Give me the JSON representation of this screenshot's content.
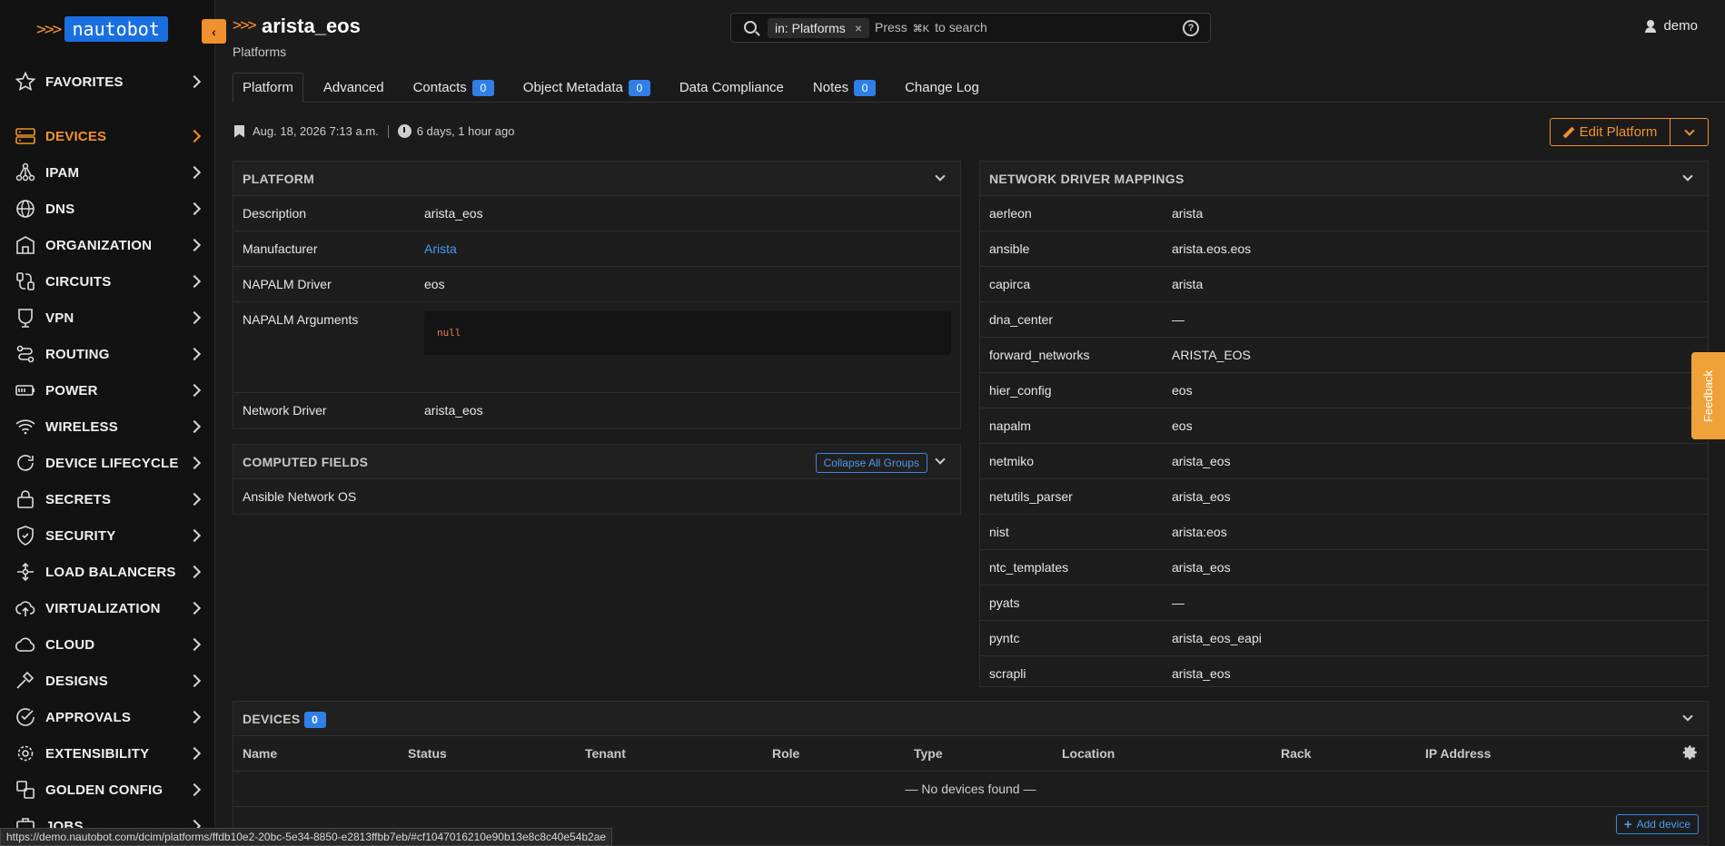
{
  "brand": {
    "logo_text": "nautobot",
    "accent": "#f0912d",
    "link": "#4b9af0"
  },
  "header": {
    "title": "arista_eos",
    "subtitle": "Platforms",
    "search_scope": "in: Platforms",
    "search_placeholder_pre": "Press",
    "search_shortcut": "⌘K",
    "search_placeholder_post": "to search",
    "user": "demo"
  },
  "sidebar": {
    "favorites": "FAVORITES",
    "items": [
      {
        "label": "DEVICES",
        "icon": "server-icon"
      },
      {
        "label": "IPAM",
        "icon": "network-icon"
      },
      {
        "label": "DNS",
        "icon": "globe-icon"
      },
      {
        "label": "ORGANIZATION",
        "icon": "building-icon"
      },
      {
        "label": "CIRCUITS",
        "icon": "cable-icon"
      },
      {
        "label": "VPN",
        "icon": "shield-icon"
      },
      {
        "label": "ROUTING",
        "icon": "route-icon"
      },
      {
        "label": "POWER",
        "icon": "battery-icon"
      },
      {
        "label": "WIRELESS",
        "icon": "wifi-icon"
      },
      {
        "label": "DEVICE LIFECYCLE",
        "icon": "refresh-icon"
      },
      {
        "label": "SECRETS",
        "icon": "lock-icon"
      },
      {
        "label": "SECURITY",
        "icon": "security-icon"
      },
      {
        "label": "LOAD BALANCERS",
        "icon": "load-balancer-icon"
      },
      {
        "label": "VIRTUALIZATION",
        "icon": "cloud-upload-icon"
      },
      {
        "label": "CLOUD",
        "icon": "cloud-icon"
      },
      {
        "label": "DESIGNS",
        "icon": "hammer-icon"
      },
      {
        "label": "APPROVALS",
        "icon": "check-circle-icon"
      },
      {
        "label": "EXTENSIBILITY",
        "icon": "cog-icon"
      },
      {
        "label": "GOLDEN CONFIG",
        "icon": "config-icon"
      },
      {
        "label": "JOBS",
        "icon": "jobs-icon"
      }
    ]
  },
  "tabs": [
    {
      "label": "Platform"
    },
    {
      "label": "Advanced"
    },
    {
      "label": "Contacts",
      "count": "0"
    },
    {
      "label": "Object Metadata",
      "count": "0"
    },
    {
      "label": "Data Compliance"
    },
    {
      "label": "Notes",
      "count": "0"
    },
    {
      "label": "Change Log"
    }
  ],
  "meta": {
    "created": "Aug. 18, 2026 7:13 a.m.",
    "updated": "6 days, 1 hour ago"
  },
  "edit_button": "Edit Platform",
  "platform_panel": {
    "title": "PLATFORM",
    "rows": [
      {
        "key": "Description",
        "value": "arista_eos"
      },
      {
        "key": "Manufacturer",
        "value": "Arista"
      },
      {
        "key": "NAPALM Driver",
        "value": "eos"
      },
      {
        "key": "NAPALM Arguments",
        "value": "null"
      },
      {
        "key": "Network Driver",
        "value": "arista_eos"
      }
    ]
  },
  "computed_panel": {
    "title": "COMPUTED FIELDS",
    "collapse_label": "Collapse All Groups",
    "rows": [
      {
        "key": "Ansible Network OS"
      }
    ]
  },
  "driver_panel": {
    "title": "NETWORK DRIVER MAPPINGS",
    "rows": [
      {
        "key": "aerleon",
        "value": "arista"
      },
      {
        "key": "ansible",
        "value": "arista.eos.eos"
      },
      {
        "key": "capirca",
        "value": "arista"
      },
      {
        "key": "dna_center",
        "value": "—"
      },
      {
        "key": "forward_networks",
        "value": "ARISTA_EOS"
      },
      {
        "key": "hier_config",
        "value": "eos"
      },
      {
        "key": "napalm",
        "value": "eos"
      },
      {
        "key": "netmiko",
        "value": "arista_eos"
      },
      {
        "key": "netutils_parser",
        "value": "arista_eos"
      },
      {
        "key": "nist",
        "value": "arista:eos"
      },
      {
        "key": "ntc_templates",
        "value": "arista_eos"
      },
      {
        "key": "pyats",
        "value": "—"
      },
      {
        "key": "pyntc",
        "value": "arista_eos_eapi"
      },
      {
        "key": "scrapli",
        "value": "arista_eos"
      }
    ]
  },
  "devices_panel": {
    "title": "DEVICES",
    "count": "0",
    "columns": [
      "Name",
      "Status",
      "Tenant",
      "Role",
      "Type",
      "Location",
      "Rack",
      "IP Address"
    ],
    "empty": "— No devices found —",
    "add_label": "Add device"
  },
  "status_url": "https://demo.nautobot.com/dcim/platforms/ffdb10e2-20bc-5e34-8850-e2813ffbb7eb/#cf1047016210e90b13e8c8c40e54b2ae",
  "feedback": "Feedback"
}
